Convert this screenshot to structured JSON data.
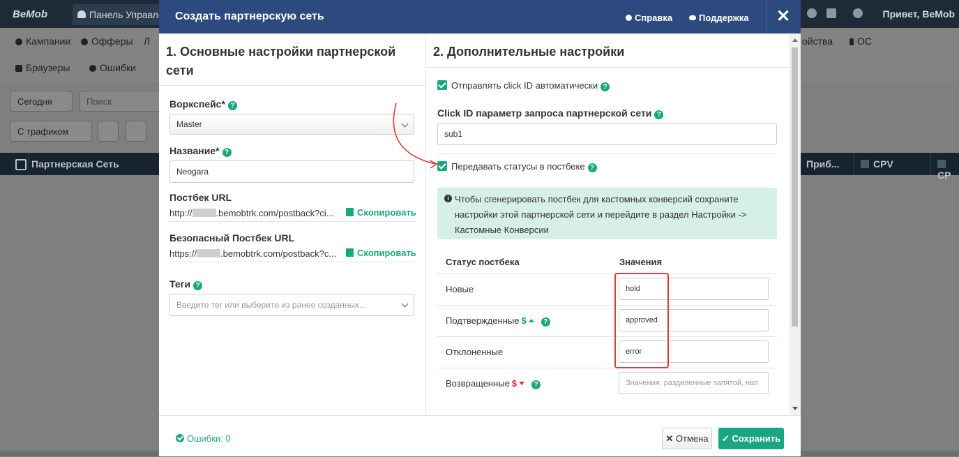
{
  "background": {
    "logo": "BeMob",
    "tab": "Панель Управле",
    "greeting": "Привет, BeMob",
    "menu_row1": [
      "Кампании",
      "Офферы",
      "Л"
    ],
    "menu_row1_right": [
      "ойства",
      "ОС"
    ],
    "menu_row2": [
      "Браузеры",
      "Ошибки"
    ],
    "date_button": "Сегодня",
    "search_placeholder": "Поиск",
    "traffic_button": "С трафиком",
    "table_headers": [
      "Партнерская Сеть",
      "Приб...",
      "CPV",
      "CP"
    ]
  },
  "modal": {
    "title": "Создать партнерскую сеть",
    "help_link": "Справка",
    "support_link": "Поддержка",
    "close": "✕",
    "left": {
      "section_title": "1. Основные настройки партнерской сети",
      "workspace_label": "Воркспейс*",
      "workspace_value": "Master",
      "name_label": "Название*",
      "name_value": "Neogara",
      "postback_label": "Постбек URL",
      "postback_prefix": "http://",
      "postback_suffix": ".bemobtrk.com/postback?ci...",
      "secure_postback_label": "Безопасный Постбек URL",
      "secure_postback_prefix": "https://",
      "secure_postback_suffix": ".bemobtrk.com/postback?c...",
      "copy_label": "Скопировать",
      "tags_label": "Теги",
      "tags_placeholder": "Введите тег или выберите из ранее созданных..."
    },
    "right": {
      "section_title": "2. Дополнительные настройки",
      "send_click_id_label": "Отправлять click ID автоматически",
      "send_click_id_checked": true,
      "click_id_param_label": "Click ID параметр запроса партнерской сети",
      "click_id_param_value": "sub1",
      "pass_statuses_label": "Передавать статусы в постбеке",
      "pass_statuses_checked": true,
      "info_text": "Чтобы сгенерировать постбек для кастомных конверсий сохраните настройки этой партнерской сети и перейдите в раздел Настройки -> Кастомные Конверсии",
      "table_header_status": "Статус постбека",
      "table_header_values": "Значения",
      "rows": [
        {
          "label": "Новые",
          "value": "hold"
        },
        {
          "label": "Подтвержденные",
          "value": "approved"
        },
        {
          "label": "Отклоненные",
          "value": "error"
        },
        {
          "label": "Возвращенные",
          "value": "",
          "placeholder": "Значения, разделенные запятой, нап"
        }
      ],
      "currency_symbol": "$"
    },
    "footer": {
      "errors_label": "Ошибки: 0",
      "cancel_label": "Отмена",
      "save_label": "Сохранить"
    }
  },
  "colors": {
    "header_bg": "#2c4a7e",
    "accent": "#1aa681",
    "highlight": "#e03b3b"
  }
}
